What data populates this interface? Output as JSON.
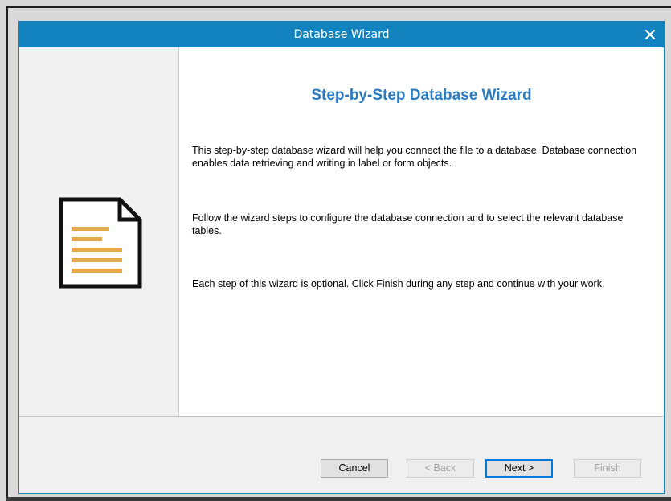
{
  "window": {
    "title": "Database Wizard",
    "close_label": "✕"
  },
  "wizard": {
    "heading": "Step-by-Step Database Wizard",
    "paragraphs": [
      "This step-by-step database wizard will help you connect the file to a database. Database connection enables data retrieving and writing in label or form objects.",
      "Follow the wizard steps to configure the database connection and to select the relevant database tables.",
      "Each step of this wizard is optional. Click Finish during any step and continue with your work."
    ],
    "side_icon": "document-icon"
  },
  "footer": {
    "cancel_label": "Cancel",
    "back_label": "< Back",
    "next_label": "Next >",
    "finish_label": "Finish"
  },
  "colors": {
    "titlebar": "#1283be",
    "heading": "#2b7bc0",
    "icon_lines": "#e8a94a"
  }
}
